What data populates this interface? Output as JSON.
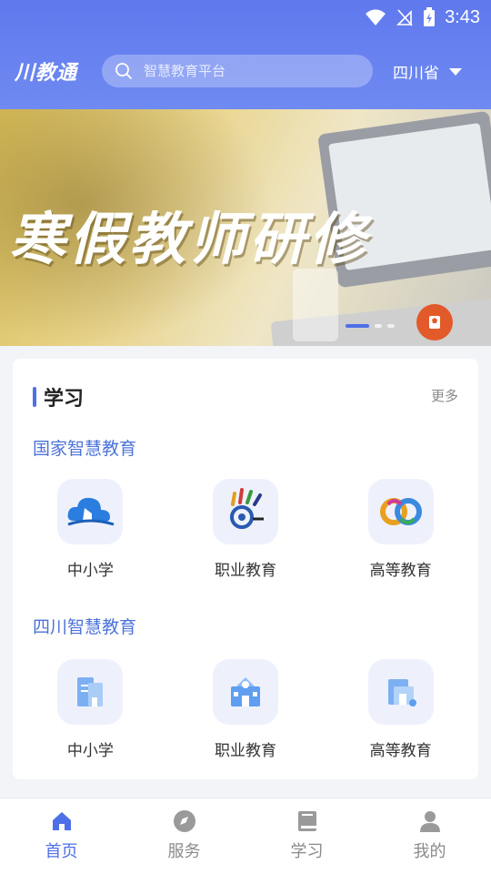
{
  "status_bar": {
    "time": "3:43"
  },
  "header": {
    "logo_text": "川教通",
    "search_placeholder": "智慧教育平台",
    "region": "四川省"
  },
  "banner": {
    "title": "寒假教师研修",
    "slide_count": 3,
    "active_slide": 1
  },
  "study_card": {
    "title": "学习",
    "more_label": "更多",
    "sections": [
      {
        "title": "国家智慧教育",
        "items": [
          {
            "label": "中小学",
            "icon": "cloud-book-icon"
          },
          {
            "label": "职业教育",
            "icon": "vocational-logo-icon"
          },
          {
            "label": "高等教育",
            "icon": "higher-edu-logo-icon"
          }
        ]
      },
      {
        "title": "四川智慧教育",
        "items": [
          {
            "label": "中小学",
            "icon": "building-icon"
          },
          {
            "label": "职业教育",
            "icon": "school-icon"
          },
          {
            "label": "高等教育",
            "icon": "university-icon"
          }
        ]
      }
    ]
  },
  "tabbar": {
    "tabs": [
      {
        "label": "首页",
        "icon": "home-icon",
        "active": true
      },
      {
        "label": "服务",
        "icon": "compass-icon",
        "active": false
      },
      {
        "label": "学习",
        "icon": "book-icon",
        "active": false
      },
      {
        "label": "我的",
        "icon": "person-icon",
        "active": false
      }
    ]
  },
  "colors": {
    "accent": "#4f6fe8",
    "header": "#6f8af1",
    "section_title": "#4c73d9"
  }
}
